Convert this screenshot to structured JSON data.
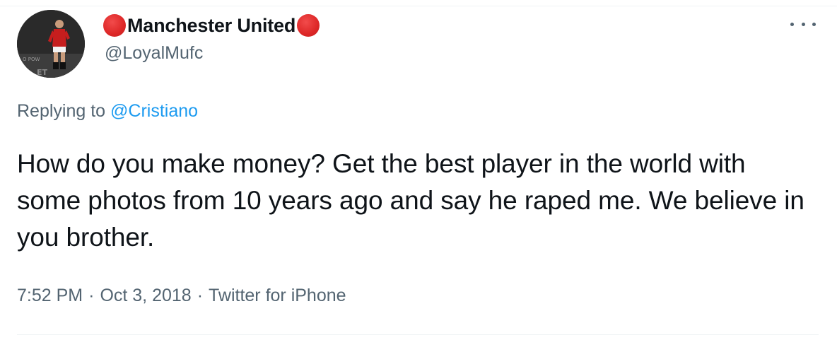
{
  "author": {
    "display_name": "Manchester United",
    "handle": "@LoyalMufc",
    "avatar_icon": "player-avatar-photo",
    "name_emoji": "red-circle-icon",
    "emoji_color": "#dd2727"
  },
  "reply": {
    "prefix": "Replying to",
    "mention": "@Cristiano"
  },
  "tweet": {
    "text": "How do you make money? Get the best player in the world with some photos from 10 years ago and say he raped me. We believe in you brother."
  },
  "meta": {
    "time": "7:52 PM",
    "separator": "·",
    "date": "Oct 3, 2018",
    "source": "Twitter for iPhone"
  },
  "icons": {
    "more": "more-options-icon"
  },
  "colors": {
    "text": "#0f1419",
    "secondary": "#536471",
    "link": "#1d9bf0",
    "divider": "#eff3f4"
  }
}
